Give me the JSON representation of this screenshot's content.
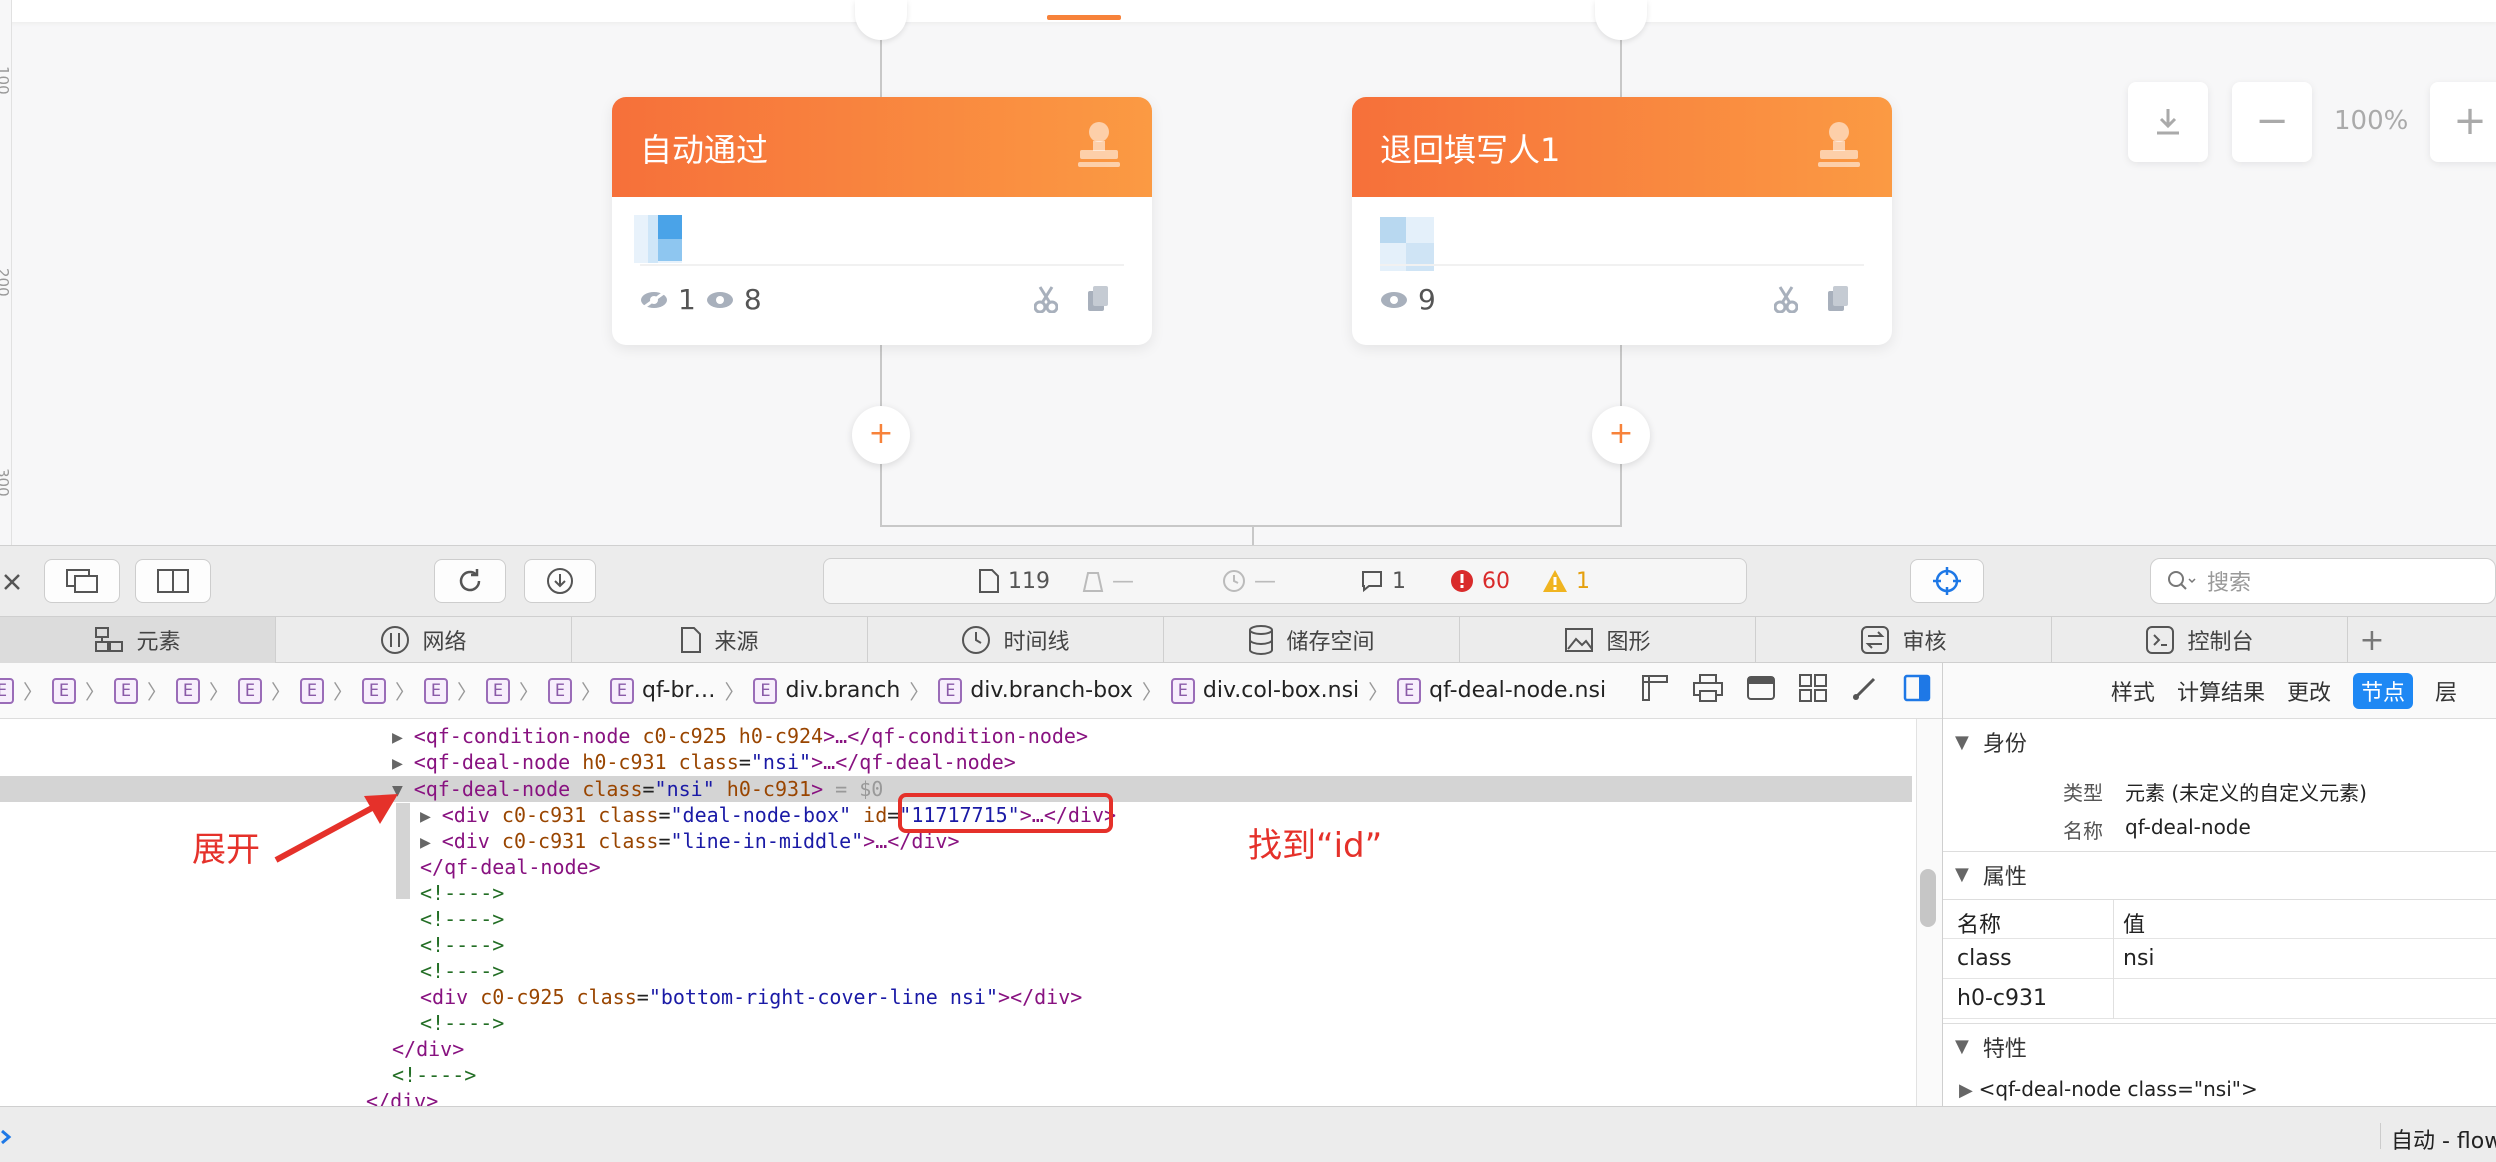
{
  "canvas": {
    "ruler_ticks": [
      "100",
      "200",
      "300"
    ],
    "cards": [
      {
        "title": "自动通过",
        "hidden_count": "1",
        "view_count": "8",
        "thumb_color": "#4aa3e8"
      },
      {
        "title": "退回填写人1",
        "view_count": "9",
        "thumb_color": "#b8d8f0"
      }
    ],
    "add_symbol": "+",
    "zoom": {
      "download_icon": "download-icon",
      "minus": "−",
      "level": "100%",
      "plus": "+"
    },
    "accent_color": "#f7823a"
  },
  "toolbar": {
    "resources_count": "119",
    "timer_a": "—",
    "timer_b": "—",
    "messages": "1",
    "errors": "60",
    "warnings": "1",
    "search_placeholder": "搜索"
  },
  "tabs": [
    {
      "label": "元素",
      "icon": "elements-icon"
    },
    {
      "label": "网络",
      "icon": "network-icon"
    },
    {
      "label": "来源",
      "icon": "sources-icon"
    },
    {
      "label": "时间线",
      "icon": "timeline-icon"
    },
    {
      "label": "储存空间",
      "icon": "storage-icon"
    },
    {
      "label": "图形",
      "icon": "graphics-icon"
    },
    {
      "label": "审核",
      "icon": "audit-icon"
    },
    {
      "label": "控制台",
      "icon": "console-icon"
    }
  ],
  "breadcrumb": {
    "badge": "E",
    "items": [
      "qf-br…",
      "div.branch",
      "div.branch-box",
      "div.col-box.nsi",
      "qf-deal-node.nsi"
    ]
  },
  "code": {
    "l1": {
      "open": "<qf-condition-node",
      "attrs": " c0-c925 h0-c924",
      "mid": ">…",
      "close": "</qf-condition-node>"
    },
    "l2": {
      "open": "<qf-deal-node",
      "a1": " h0-c931 ",
      "cn": "class",
      "eq": "=",
      "cv": "\"nsi\"",
      "mid": ">…",
      "close": "</qf-deal-node>"
    },
    "l3": {
      "open": "<qf-deal-node",
      "cn": " class",
      "eq": "=",
      "cv": "\"nsi\"",
      "a2": " h0-c931",
      "end": ">",
      "sel": " = $0"
    },
    "l4": {
      "open": "<div",
      "a1": " c0-c931 ",
      "cn": "class",
      "eq": "=",
      "cv": "\"deal-node-box\"",
      "idn": " id",
      "ideq": "=",
      "idv": "\"11717715\"",
      "mid": ">…",
      "close": "</div>"
    },
    "l5": {
      "open": "<div",
      "a1": " c0-c931 ",
      "cn": "class",
      "eq": "=",
      "cv": "\"line-in-middle\"",
      "mid": ">…",
      "close": "</div>"
    },
    "l6": "</qf-deal-node>",
    "comment": "<!---->",
    "l11": {
      "open": "<div",
      "a1": " c0-c925 ",
      "cn": "class",
      "eq": "=",
      "cv": "\"bottom-right-cover-line nsi\"",
      "end": ">",
      "close": "</div>"
    },
    "l13": "</div>",
    "l15": "</div>"
  },
  "annotations": {
    "expand": "展开",
    "find_id": "找到“id”"
  },
  "sidebar": {
    "tabs": [
      "样式",
      "计算结果",
      "更改",
      "节点",
      "层"
    ],
    "active_tab": "节点",
    "identity": {
      "title": "身份",
      "type_label": "类型",
      "type_value": "元素 (未定义的自定义元素)",
      "name_label": "名称",
      "name_value": "qf-deal-node"
    },
    "attributes": {
      "title": "属性",
      "col_name": "名称",
      "col_value": "值",
      "rows": [
        {
          "name": "class",
          "value": "nsi"
        },
        {
          "name": "h0-c931",
          "value": ""
        }
      ]
    },
    "properties": {
      "title": "特性",
      "first": "<qf-deal-node class=\"nsi\">"
    }
  },
  "bottombar": {
    "context": "自动 - flow"
  }
}
